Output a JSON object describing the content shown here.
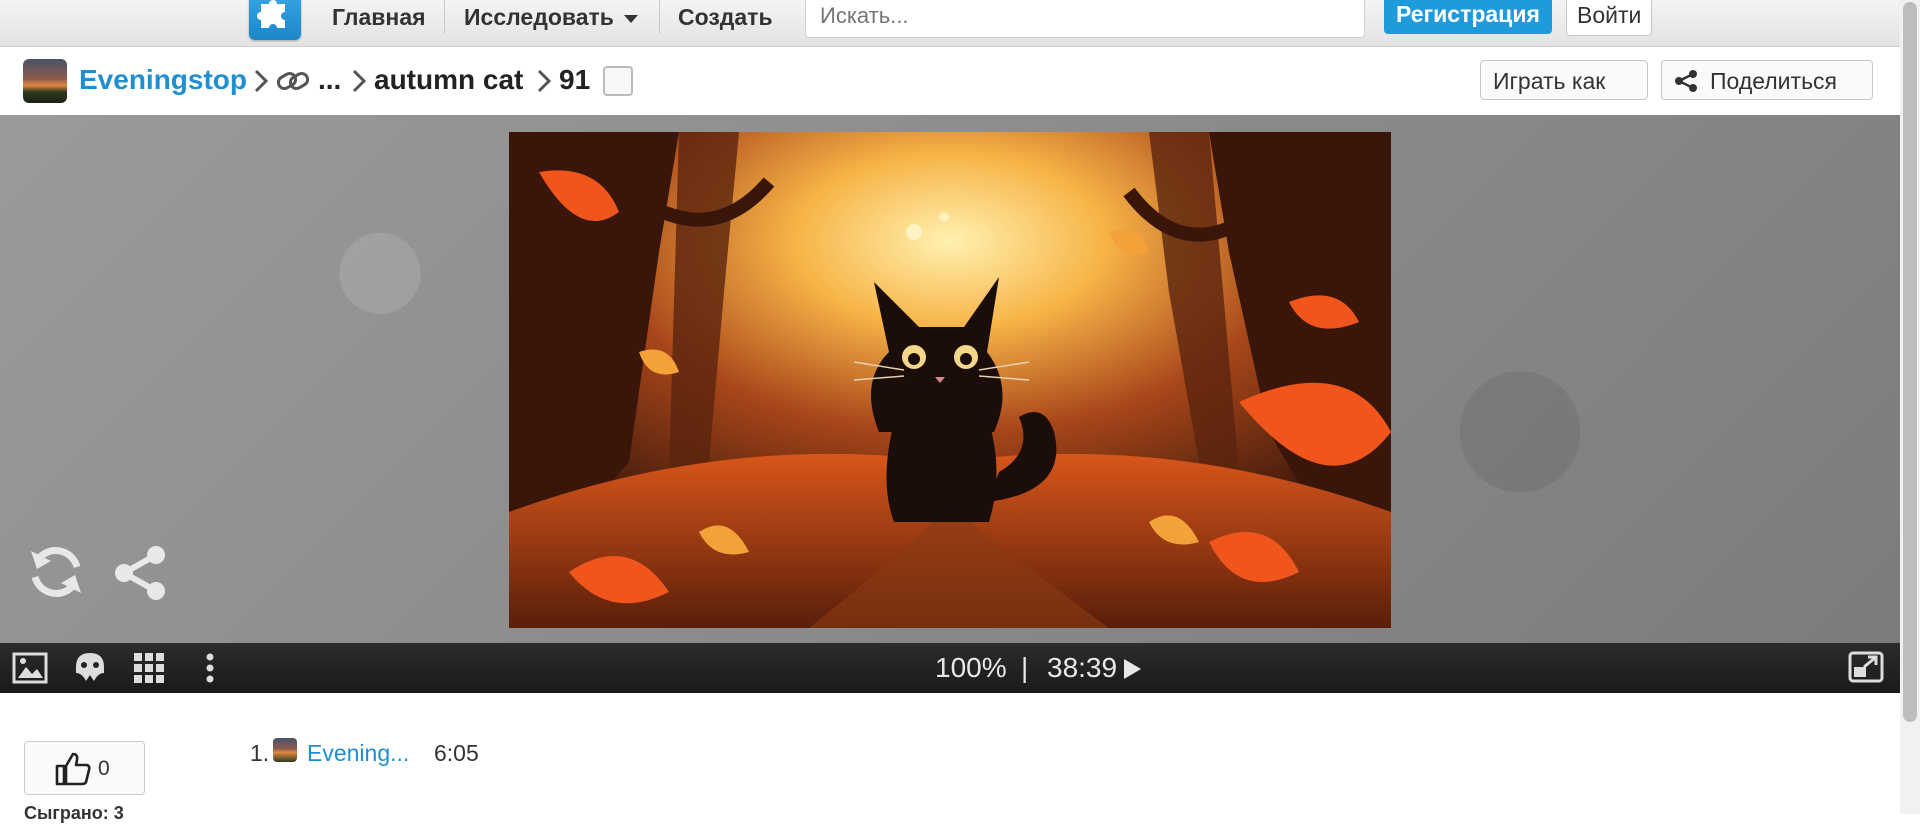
{
  "nav": {
    "home": "Главная",
    "explore": "Исследовать",
    "create": "Создать",
    "search_placeholder": "Искать...",
    "register": "Регистрация",
    "login": "Войти"
  },
  "breadcrumb": {
    "user": "Eveningstop",
    "ellipsis": "...",
    "collection": "autumn cat",
    "pieces": "91"
  },
  "actions": {
    "play_as": "Играть как",
    "share": "Поделиться"
  },
  "player": {
    "zoom": "100%",
    "separator": "|",
    "time": "38:39"
  },
  "likes": {
    "count": "0"
  },
  "leaderboard": [
    {
      "rank": "1.",
      "name": "Evening...",
      "time": "6:05"
    }
  ],
  "played_label": "Сыграно: 3",
  "colors": {
    "accent": "#1f9bdc",
    "link": "#1f8fd0",
    "playerbar": "#1f1f1f"
  }
}
